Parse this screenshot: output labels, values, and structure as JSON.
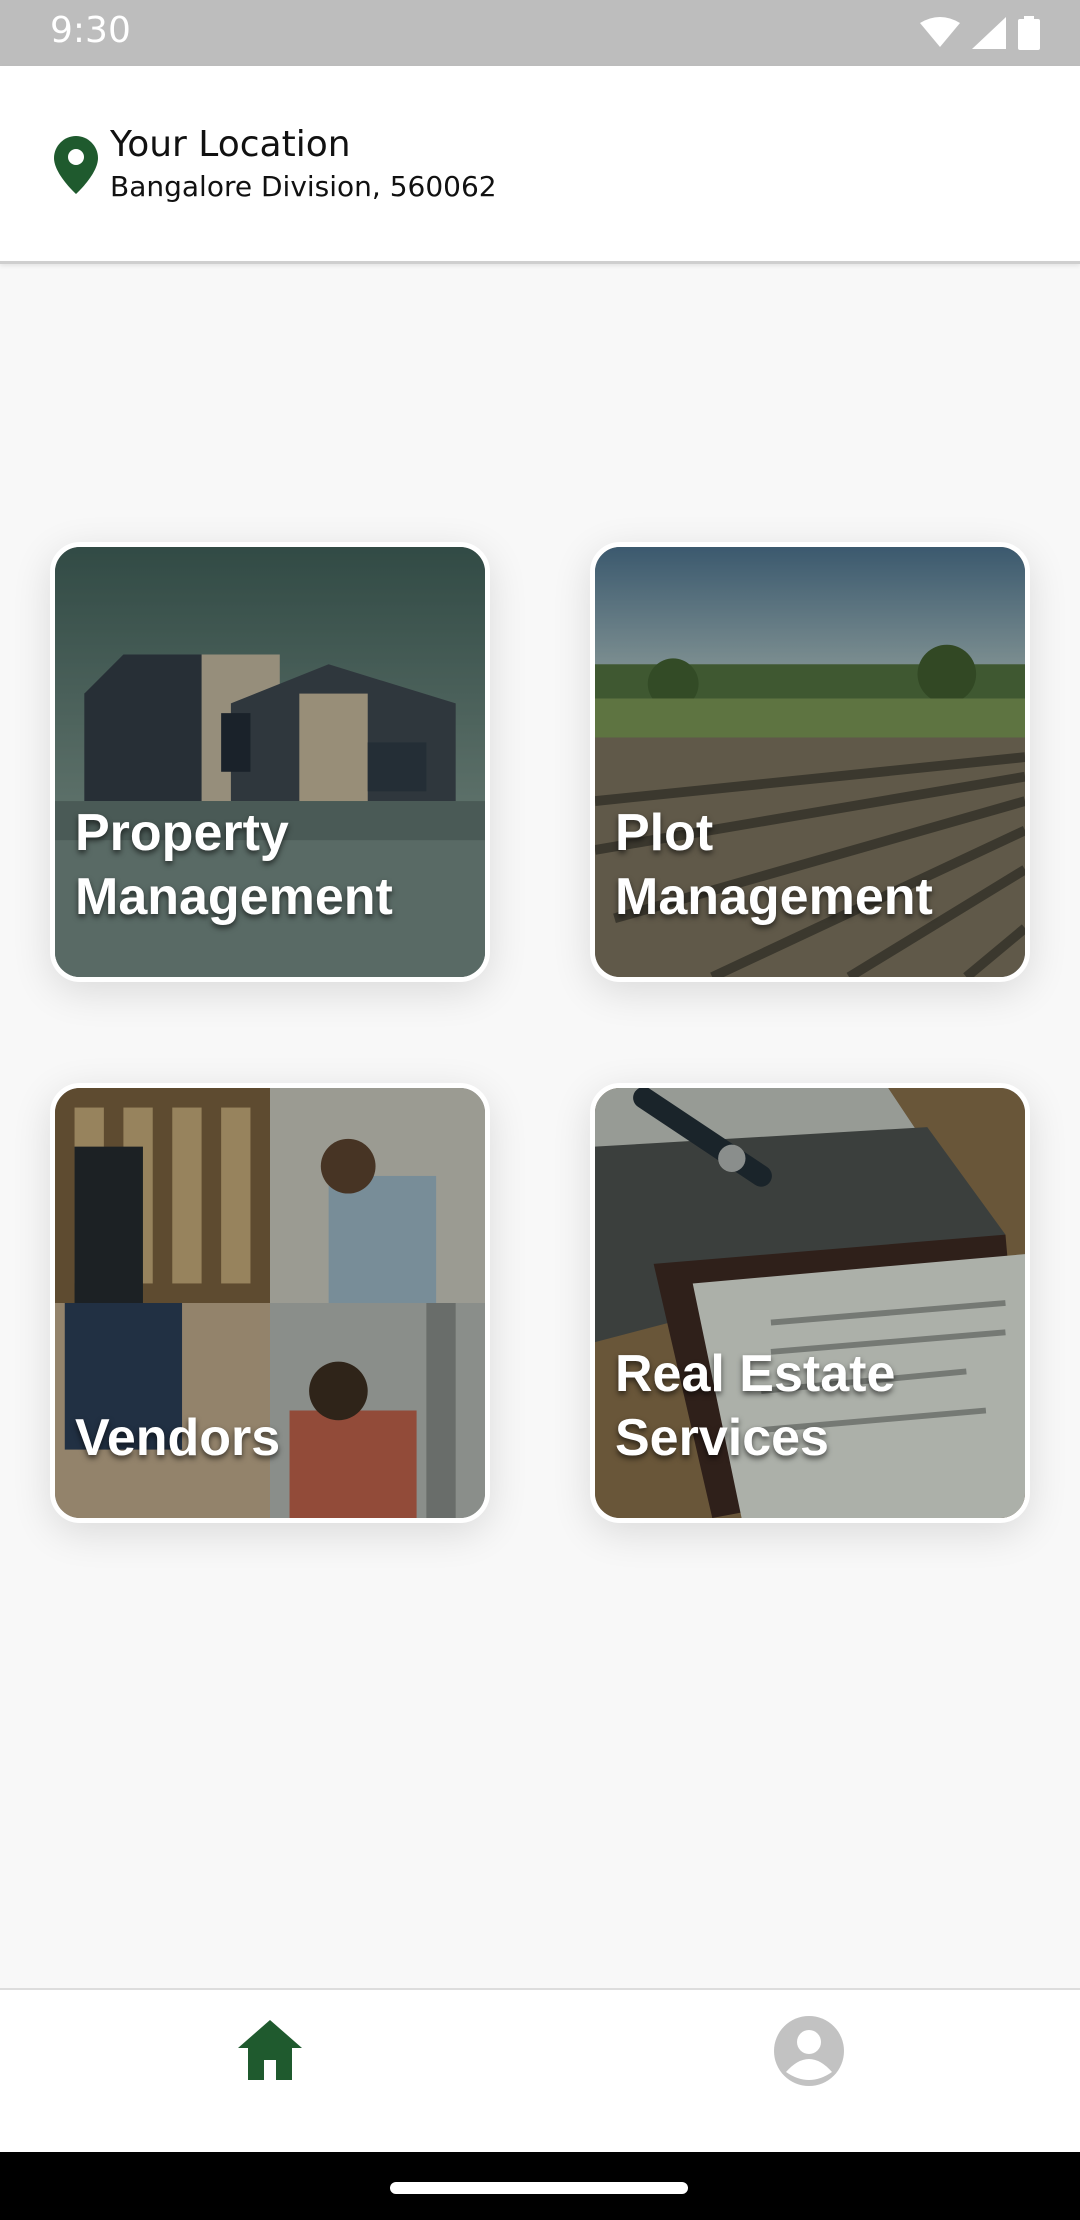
{
  "status_bar": {
    "time": "9:30",
    "icons": [
      "wifi-icon",
      "cell-signal-icon",
      "battery-icon"
    ]
  },
  "header": {
    "title": "Your Location",
    "subtitle": "Bangalore Division, 560062",
    "icon": "location-pin-icon",
    "accent_color": "#1f5a2e"
  },
  "tiles": [
    {
      "label": "Property\nManagement",
      "image": "modern-house-photo"
    },
    {
      "label": "Plot\nManagement",
      "image": "plowed-field-photo"
    },
    {
      "label": "Vendors",
      "image": "workers-collage-photo"
    },
    {
      "label": "Real Estate\nServices",
      "image": "documents-pen-photo"
    }
  ],
  "bottom_nav": {
    "items": [
      {
        "icon": "home-icon",
        "active": true,
        "color": "#1f5a2e"
      },
      {
        "icon": "profile-icon",
        "active": false,
        "color": "#bdbdbd"
      }
    ]
  }
}
